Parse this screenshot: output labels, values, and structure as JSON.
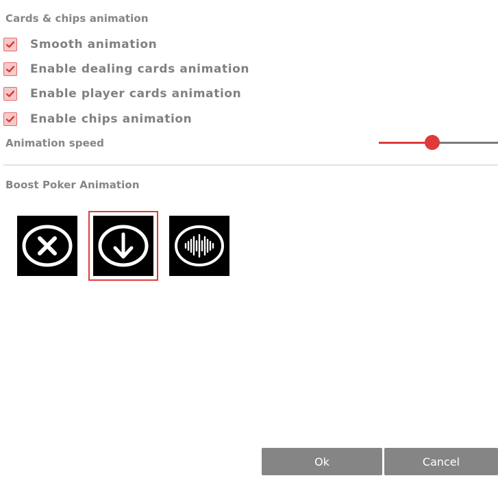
{
  "cards_chips_section": {
    "title": "Cards & chips animation",
    "checkboxes": [
      {
        "label": "Smooth animation",
        "checked": true
      },
      {
        "label": "Enable dealing cards animation",
        "checked": true
      },
      {
        "label": "Enable player cards animation",
        "checked": true
      },
      {
        "label": "Enable chips animation",
        "checked": true
      }
    ],
    "animation_speed": {
      "label": "Animation speed",
      "value_fraction": 0.45
    }
  },
  "boost_section": {
    "title": "Boost Poker Animation",
    "options": [
      {
        "icon": "close-circle-icon",
        "selected": false
      },
      {
        "icon": "arrow-down-circle-icon",
        "selected": true
      },
      {
        "icon": "sound-wave-circle-icon",
        "selected": false
      }
    ]
  },
  "footer": {
    "ok_label": "Ok",
    "cancel_label": "Cancel"
  },
  "colors": {
    "accent": "#e0393a",
    "checkbox_fill": "#f6c9c9",
    "button_bg": "#858585",
    "text": "#808080"
  }
}
